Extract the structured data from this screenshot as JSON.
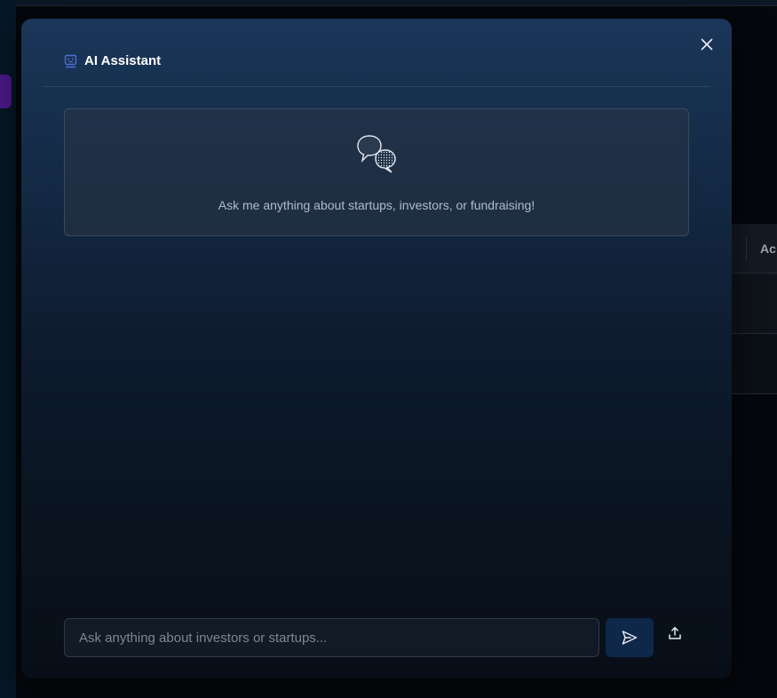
{
  "background": {
    "column_header": "Ac",
    "accent_color": "#4a1a8a"
  },
  "modal": {
    "title": "AI Assistant",
    "title_icon": "robot-icon",
    "close_icon": "close-icon",
    "welcome": {
      "icon": "chat-bubbles-icon",
      "message": "Ask me anything about startups, investors, or fundraising!"
    },
    "input": {
      "placeholder": "Ask anything about investors or startups...",
      "value": ""
    },
    "send_icon": "send-icon",
    "upload_icon": "upload-icon",
    "colors": {
      "header_top": "#1a3659",
      "bottom": "#080e17",
      "send_button": "#0f2749",
      "icon_accent": "#4f6fd8"
    }
  }
}
